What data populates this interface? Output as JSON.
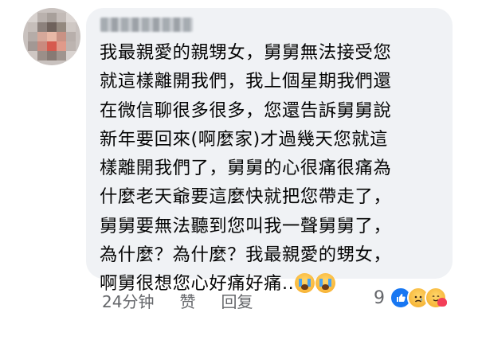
{
  "author": {
    "name": ""
  },
  "comment": {
    "lines": [
      "我最親愛的親甥女，舅舅無法接受您",
      "就這樣離開我們，我上個星期我們還",
      "在微信聊很多很多，您還告訴舅舅說",
      "新年要回來(啊麼家)才過幾天您就這",
      "樣離開我們了，舅舅的心很痛很痛為",
      "什麼老天爺要這麼快就把您帶走了，",
      "舅舅要無法聽到您叫我一聲舅舅了，",
      "為什麼？為什麼？我最親愛的甥女，",
      "啊舅很想您心好痛好痛.."
    ],
    "emojis": [
      "crying-face",
      "crying-face"
    ]
  },
  "footer": {
    "time": "24分钟",
    "like_label": "赞",
    "reply_label": "回复"
  },
  "reactions": {
    "count": "9",
    "types": [
      "like",
      "sad",
      "care"
    ],
    "colors": {
      "like": "#1877f2",
      "care_heart": "#f33e58"
    }
  },
  "colors": {
    "bubble": "#f0f2f5",
    "meta_text": "#65676b",
    "text": "#050505"
  }
}
